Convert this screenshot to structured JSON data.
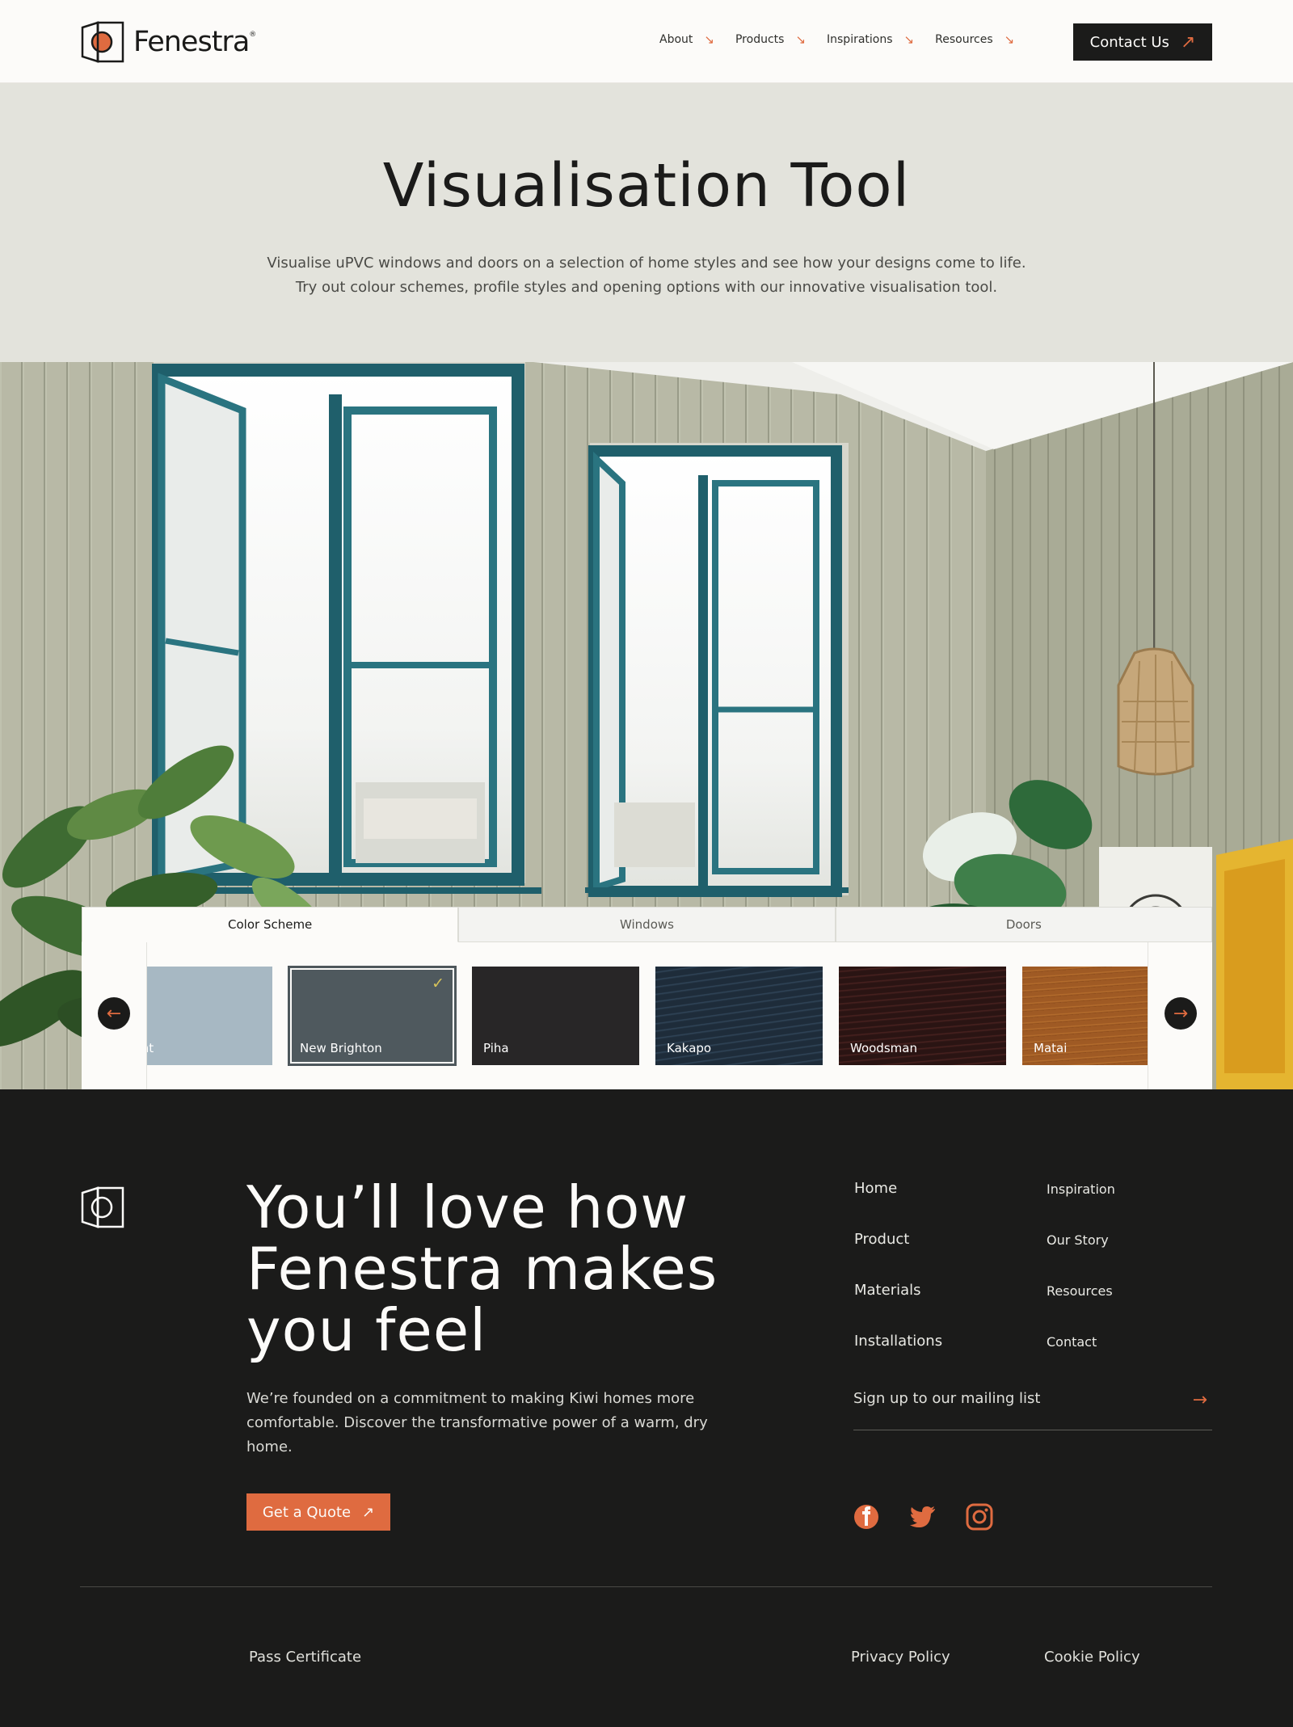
{
  "header": {
    "logo_text": "Fenestra",
    "logo_mark": "®",
    "nav": [
      {
        "label": "About",
        "icon": "arrow-down-right-icon"
      },
      {
        "label": "Products",
        "icon": "arrow-down-right-icon"
      },
      {
        "label": "Inspirations",
        "icon": "arrow-down-right-icon"
      },
      {
        "label": "Resources",
        "icon": "arrow-down-right-icon"
      }
    ],
    "contact_label": "Contact Us"
  },
  "hero": {
    "title": "Visualisation Tool",
    "line1": "Visualise uPVC windows and doors on a selection of home styles and see how your designs come to life.",
    "line2": "Try out colour schemes, profile styles and opening options with our innovative visualisation tool."
  },
  "tool": {
    "tabs": [
      {
        "label": "Color Scheme",
        "active": true
      },
      {
        "label": "Windows",
        "active": false
      },
      {
        "label": "Doors",
        "active": false
      }
    ],
    "swatches": [
      {
        "name": "i Point",
        "color": "#a7b8c3"
      },
      {
        "name": "New Brighton",
        "color": "#4f595e",
        "selected": true
      },
      {
        "name": "Piha",
        "color": "#282627"
      },
      {
        "name": "Kakapo",
        "color": "#1e2c3a"
      },
      {
        "name": "Woodsman",
        "color": "#2a1413"
      },
      {
        "name": "Matai",
        "color": "#9f5a24"
      }
    ]
  },
  "footer": {
    "headline": "You’ll love how Fenestra makes you feel",
    "description": "We’re founded on a commitment to making Kiwi homes more comfortable. Discover the transformative power of a warm, dry home.",
    "quote_label": "Get a Quote",
    "links_col1": [
      "Home",
      "Product",
      "Materials",
      "Installations"
    ],
    "links_col2": [
      "Inspiration",
      "Our Story",
      "Resources",
      "Contact"
    ],
    "mailing_label": "Sign up to our mailing list",
    "social": [
      "facebook-icon",
      "twitter-icon",
      "instagram-icon"
    ],
    "pass_certificate": "Pass Certificate",
    "privacy": "Privacy Policy",
    "cookie": "Cookie Policy"
  },
  "colors": {
    "accent": "#df6b40",
    "dark": "#1b1b1a",
    "hero_bg": "#e3e3dc",
    "window_frame": "#1f5f6b"
  }
}
